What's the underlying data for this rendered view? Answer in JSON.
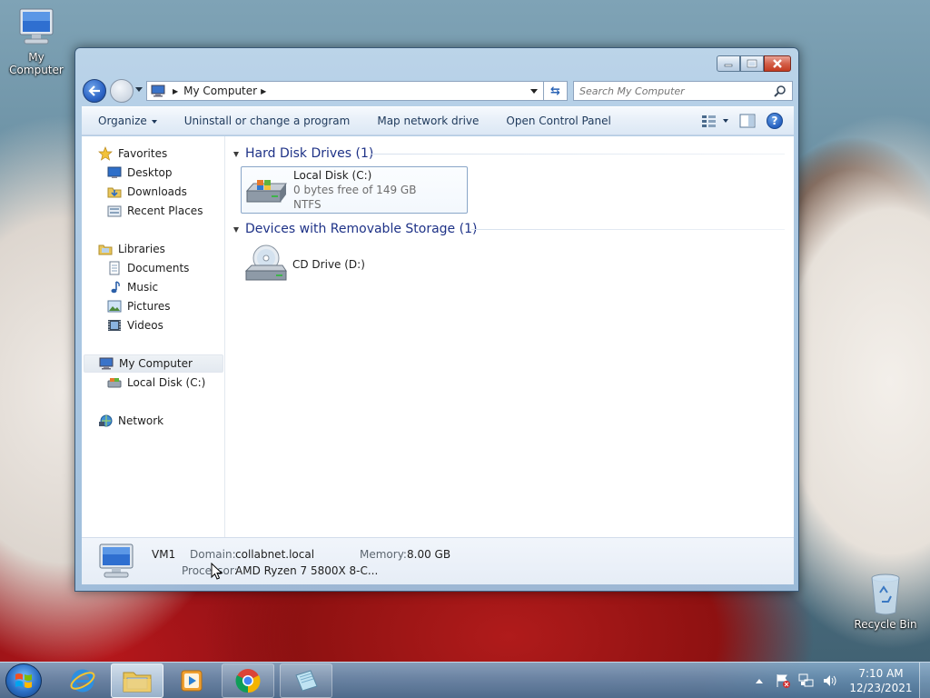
{
  "desktop": {
    "icons": [
      {
        "label": "My Computer",
        "icon": "computer-icon"
      },
      {
        "label": "Recycle Bin",
        "icon": "recycle-bin-icon"
      }
    ]
  },
  "window": {
    "address": {
      "location": "My Computer"
    },
    "search": {
      "placeholder": "Search My Computer"
    },
    "toolbar": {
      "organize": "Organize",
      "uninstall": "Uninstall or change a program",
      "map_drive": "Map network drive",
      "control_panel": "Open Control Panel"
    },
    "nav": {
      "favorites": "Favorites",
      "desktop": "Desktop",
      "downloads": "Downloads",
      "recent_places": "Recent Places",
      "libraries": "Libraries",
      "documents": "Documents",
      "music": "Music",
      "pictures": "Pictures",
      "videos": "Videos",
      "my_computer": "My Computer",
      "local_disk": "Local Disk (C:)",
      "network": "Network"
    },
    "groups": {
      "hdd": {
        "title": "Hard Disk Drives (1)",
        "drive": {
          "name": "Local Disk (C:)",
          "free": "0 bytes free of 149 GB",
          "fs": "NTFS"
        }
      },
      "removable": {
        "title": "Devices with Removable Storage (1)",
        "drive": {
          "name": "CD Drive (D:)"
        }
      }
    },
    "details": {
      "name": "VM1",
      "domain_label": "Domain:",
      "domain_value": "collabnet.local",
      "memory_label": "Memory:",
      "memory_value": "8.00 GB",
      "processor_label": "Processor:",
      "processor_value": "AMD Ryzen 7 5800X 8-C..."
    }
  },
  "taskbar": {
    "clock": {
      "time": "7:10 AM",
      "date": "12/23/2021"
    }
  }
}
